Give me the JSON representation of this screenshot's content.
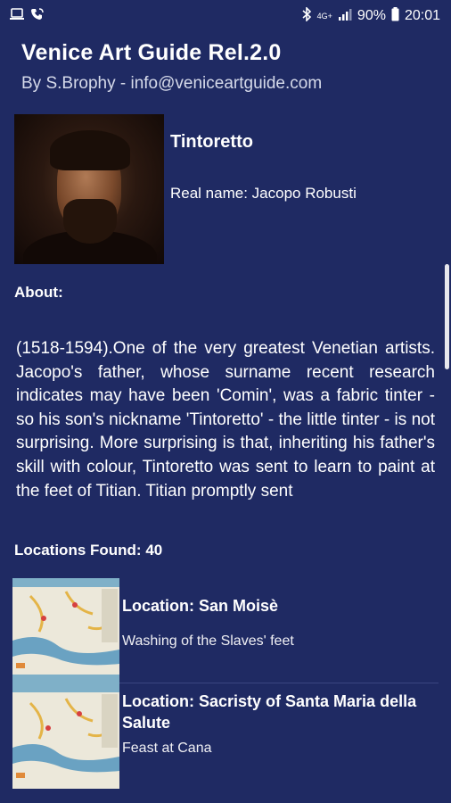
{
  "status_bar": {
    "left_icons": [
      "laptop-icon",
      "wifi-call-icon"
    ],
    "right_icons": [
      "bluetooth-icon",
      "lte-icon",
      "signal-icon"
    ],
    "network": "4G+",
    "battery": "90%",
    "time": "20:01"
  },
  "header": {
    "title": "Venice Art Guide Rel.2.0",
    "subtitle": "By S.Brophy - info@veniceartguide.com"
  },
  "artist": {
    "name": "Tintoretto",
    "real_name": "Real name: Jacopo Robusti"
  },
  "about": {
    "label": "About:",
    "text": "(1518-1594).One of the very greatest Venetian artists. Jacopo's father, whose surname recent research indicates may have been 'Comin', was a fabric tinter - so his son's nickname 'Tintoretto' - the little tinter - is not surprising. More surprising is that, inheriting his father's skill with colour, Tintoretto was sent to learn to paint at the feet of Titian. Titian promptly sent"
  },
  "locations": {
    "label": "Locations Found: 40",
    "items": [
      {
        "title": "Location: San Moisè",
        "work": "Washing of the Slaves' feet"
      },
      {
        "title": "Location: Sacristy of Santa Maria della Salute",
        "work": "Feast at Cana"
      }
    ]
  },
  "colors": {
    "background": "#1f2a63",
    "text": "#ffffff",
    "divider": "#3a4680"
  }
}
